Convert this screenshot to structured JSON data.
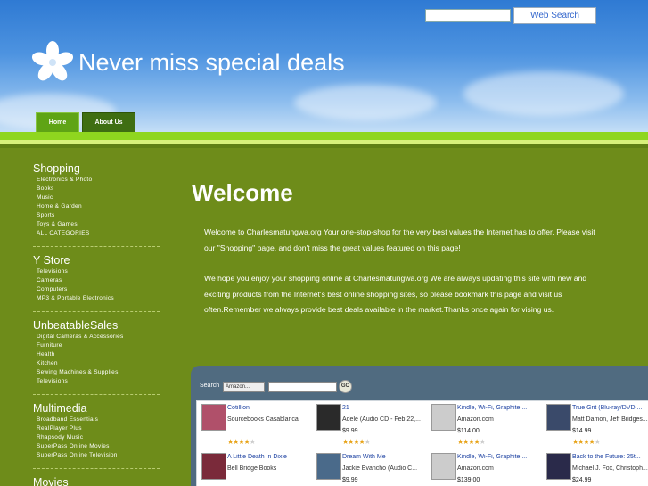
{
  "header": {
    "search_button": "Web Search",
    "site_title": "Never miss special deals"
  },
  "nav": {
    "home": "Home",
    "about": "About Us"
  },
  "sidebar": [
    {
      "title": "Shopping",
      "items": [
        "Electronics & Photo",
        "Books",
        "Music",
        "Home & Garden",
        "Sports",
        "Toys & Games",
        "ALL CATEGORIES"
      ]
    },
    {
      "title": "Y Store",
      "items": [
        "Televisions",
        "Cameras",
        "Computers",
        "MP3 & Portable Electronics"
      ]
    },
    {
      "title": "UnbeatableSales",
      "items": [
        "Digital Cameras & Accessories",
        "Furniture",
        "Health",
        "Kitchen",
        "Sewing Machines & Supplies",
        "Televisions"
      ]
    },
    {
      "title": "Multimedia",
      "items": [
        "Broadband Essentials",
        "RealPlayer Plus",
        "Rhapsody Music",
        "SuperPass Online Movies",
        "SuperPass Online Television"
      ]
    },
    {
      "title": "Movies",
      "items": []
    }
  ],
  "main": {
    "title": "Welcome",
    "para1": "Welcome to Charlesmatungwa.org Your one-stop-shop for the very best values the Internet has to offer. Please visit our \"Shopping\" page, and don't miss the great values featured on this page!",
    "para2": "We hope you enjoy your shopping online at Charlesmatungwa.org We are always updating this site with new and exciting products from the Internet's best online shopping sites, so please bookmark this page and visit us often.Remember we always provide best deals available in the market.Thanks once again for vising us."
  },
  "widget": {
    "search_label": "Search",
    "select_value": "Amazon...",
    "go_label": "GO",
    "products": [
      {
        "title": "Cotillion",
        "sub": "Sourcebooks Casablanca",
        "price": "",
        "stars": 4,
        "thumb_color": "#b0506a"
      },
      {
        "title": "21",
        "sub": "Adele (Audio CD - Feb 22,...",
        "price": "$9.99",
        "stars": 4,
        "thumb_color": "#2a2a2a"
      },
      {
        "title": "Kindle, Wi-Fi, Graphite,...",
        "sub": "Amazon.com",
        "price": "$114.00",
        "stars": 4,
        "thumb_color": "#cccccc"
      },
      {
        "title": "True Grit (Blu-ray/DVD ...",
        "sub": "Matt Damon, Jeff Bridges...",
        "price": "$14.99",
        "stars": 4,
        "thumb_color": "#3a4a6a"
      },
      {
        "title": "A Little Death In Dixie",
        "sub": "Bell Bridge Books",
        "price": "",
        "stars": 4,
        "thumb_color": "#7a2a3a"
      },
      {
        "title": "Dream With Me",
        "sub": "Jackie Evancho (Audio C...",
        "price": "$9.99",
        "stars": 4,
        "thumb_color": "#4a6a8a"
      },
      {
        "title": "Kindle, Wi-Fi, Graphite,...",
        "sub": "Amazon.com",
        "price": "$139.00",
        "stars": 4,
        "thumb_color": "#cccccc"
      },
      {
        "title": "Back to the Future: 25t...",
        "sub": "Michael J. Fox, Christoph...",
        "price": "$24.99",
        "stars": 4,
        "thumb_color": "#2a2a4a"
      }
    ]
  }
}
